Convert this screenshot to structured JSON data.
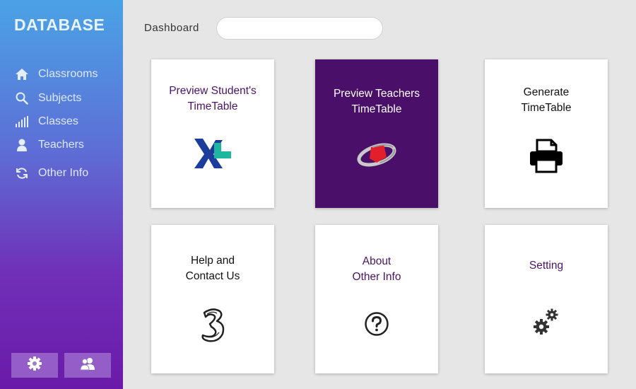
{
  "sidebar": {
    "brand": "DATABASE",
    "items": [
      {
        "label": "Classrooms",
        "icon": "home-icon"
      },
      {
        "label": "Subjects",
        "icon": "search-icon"
      },
      {
        "label": "Classes",
        "icon": "signal-bars-icon"
      },
      {
        "label": "Teachers",
        "icon": "user-icon"
      },
      {
        "label": "Other Info",
        "icon": "refresh-icon"
      }
    ],
    "bottom_buttons": [
      {
        "icon": "gear-icon"
      },
      {
        "icon": "users-icon"
      }
    ]
  },
  "header": {
    "title": "Dashboard",
    "search_value": ""
  },
  "cards": [
    {
      "title": "Preview Student's\nTimeTable",
      "icon": "xl-logo-icon",
      "style": "light",
      "title_color": "#4a1466"
    },
    {
      "title": "Preview Teachers\nTimeTable",
      "icon": "telkomsel-logo-icon",
      "style": "dark",
      "title_color": "#ffffff"
    },
    {
      "title": "Generate\nTimeTable",
      "icon": "printer-icon",
      "style": "light",
      "title_color": "#111111"
    },
    {
      "title": "Help and\nContact Us",
      "icon": "three-logo-icon",
      "style": "light",
      "title_color": "#111111"
    },
    {
      "title": "About\nOther Info",
      "icon": "question-circle-icon",
      "style": "light",
      "title_color": "#4a1466"
    },
    {
      "title": "Setting",
      "icon": "gears-icon",
      "style": "light",
      "title_color": "#4a1466"
    }
  ],
  "colors": {
    "sidebar_top": "#4aa3e6",
    "sidebar_bottom": "#6a1aa8",
    "dark_card": "#4a0f68",
    "background": "#e6e6e6"
  }
}
